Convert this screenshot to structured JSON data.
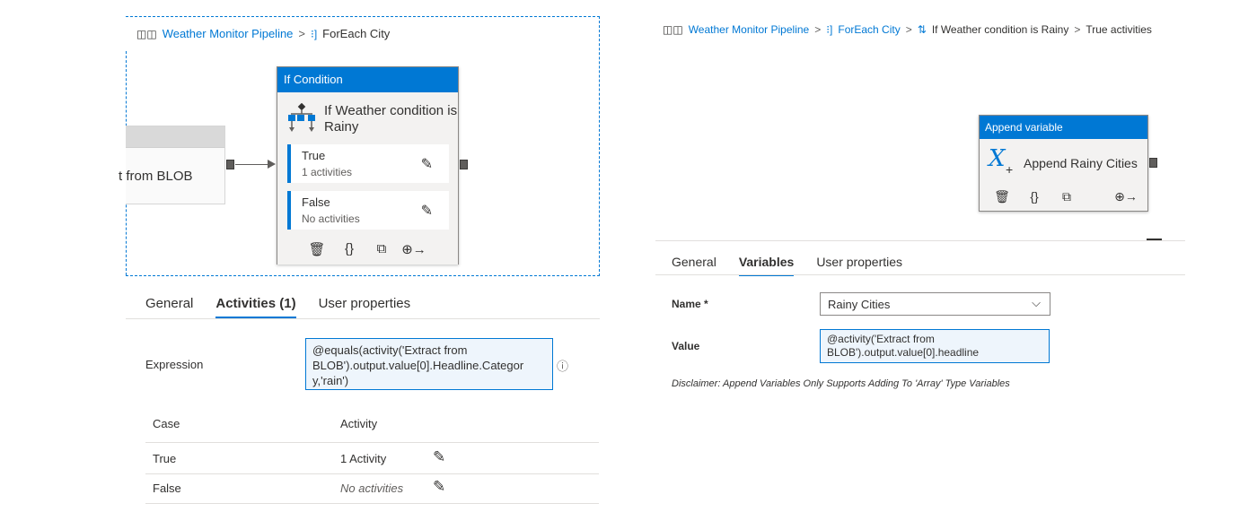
{
  "left": {
    "breadcrumb": {
      "pipeline": "Weather Monitor Pipeline",
      "sep1": ">",
      "foreach": "ForEach City"
    },
    "extract_activity_partial": "t from BLOB",
    "if_activity": {
      "header": "If Condition",
      "title": "If Weather condition is Rainy",
      "cases": [
        {
          "label": "True",
          "sub": "1 activities"
        },
        {
          "label": "False",
          "sub": "No activities"
        }
      ],
      "toolbar_icons": [
        "delete-icon",
        "code-icon",
        "copy-icon",
        "add-output-icon"
      ]
    },
    "tabs": [
      "General",
      "Activities (1)",
      "User properties"
    ],
    "active_tab": "Activities (1)",
    "expression": {
      "label": "Expression",
      "lines": [
        "@equals(activity('Extract from",
        "BLOB').output.value[0].Headline.Categor",
        "y,'rain')"
      ]
    },
    "table": {
      "headers": [
        "Case",
        "Activity"
      ],
      "rows": [
        {
          "case": "True",
          "activity": "1 Activity"
        },
        {
          "case": "False",
          "activity": "No activities"
        }
      ]
    }
  },
  "right": {
    "breadcrumb": {
      "pipeline": "Weather Monitor Pipeline",
      "foreach": "ForEach City",
      "ifcond": "If Weather condition is Rainy",
      "last": "True activities",
      "sep": ">"
    },
    "append_activity": {
      "header": "Append variable",
      "title": "Append Rainy Cities",
      "icon_glyph": "X"
    },
    "tabs": [
      "General",
      "Variables",
      "User properties"
    ],
    "active_tab": "Variables",
    "name_label": "Name *",
    "name_value": "Rainy Cities",
    "value_label": "Value",
    "value_lines": [
      "@activity('Extract from",
      "BLOB').output.value[0].headline"
    ],
    "disclaimer": "Disclaimer: Append Variables Only Supports Adding To 'Array' Type Variables"
  },
  "colors": {
    "accent": "#0078d4",
    "text": "#323130",
    "muted": "#605e5c"
  }
}
